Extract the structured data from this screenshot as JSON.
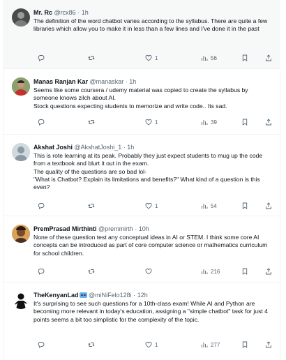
{
  "tweets": [
    {
      "name": "Mr. Rc",
      "handle": "@rcx86",
      "time": "1h",
      "text": "The definition of the word chatbot varies according to the syllabus. There are quite a few libraries which allow you to make it in less than a few lines and I've done it in the past",
      "likes": "1",
      "views": "56",
      "avatar": "avatar-dark"
    },
    {
      "name": "Manas Ranjan Kar",
      "handle": "@manaskar",
      "time": "1h",
      "text": "Seems like some coursera / udemy material was copied to create the syllabus by someone knows zilch about AI.\nStock questions expecting students to memorize and write code.. Its sad.",
      "likes": "1",
      "views": "39",
      "avatar": "avatar-photo-red"
    },
    {
      "name": "Akshat Joshi",
      "handle": "@AkshatJoshi_1",
      "time": "1h",
      "text": "This is rote learning at its peak. Probably they just expect students to mug up the code from a textbook and blurt it out in the exam.\nThe quality of the questions are so bad lol-\n\"What is Chatbot? Explain its limitations and benefits?\" What kind of a question is this even?",
      "likes": "1",
      "views": "54",
      "avatar": "avatar-default"
    },
    {
      "name": "PremPrasad Mirthinti",
      "handle": "@premmirth",
      "time": "10h",
      "text": "None of these question test any conceptual ideas in AI or STEM. I think some core AI concepts can be introduced as part of core computer science or mathematics curriculum for school children.",
      "likes": "",
      "views": "216",
      "avatar": "avatar-photo-warm"
    },
    {
      "name": "TheKenyanLad",
      "handle": "@miNiFelo128i",
      "time": "12h",
      "text": "It's surprising to see such questions for a 10th-class exam! While AI and Python are becoming more relevant in today's education, assigning a \"simple chatbot\" task for just 4 points seems a bit too simplistic for the complexity of the topic.",
      "likes": "1",
      "views": "277",
      "avatar": "avatar-black-figure"
    }
  ],
  "separator": " · ",
  "colors": {
    "muted": "#536471",
    "text": "#0f1419",
    "border": "#eff3f4",
    "shaded": "#f7f9f9"
  }
}
